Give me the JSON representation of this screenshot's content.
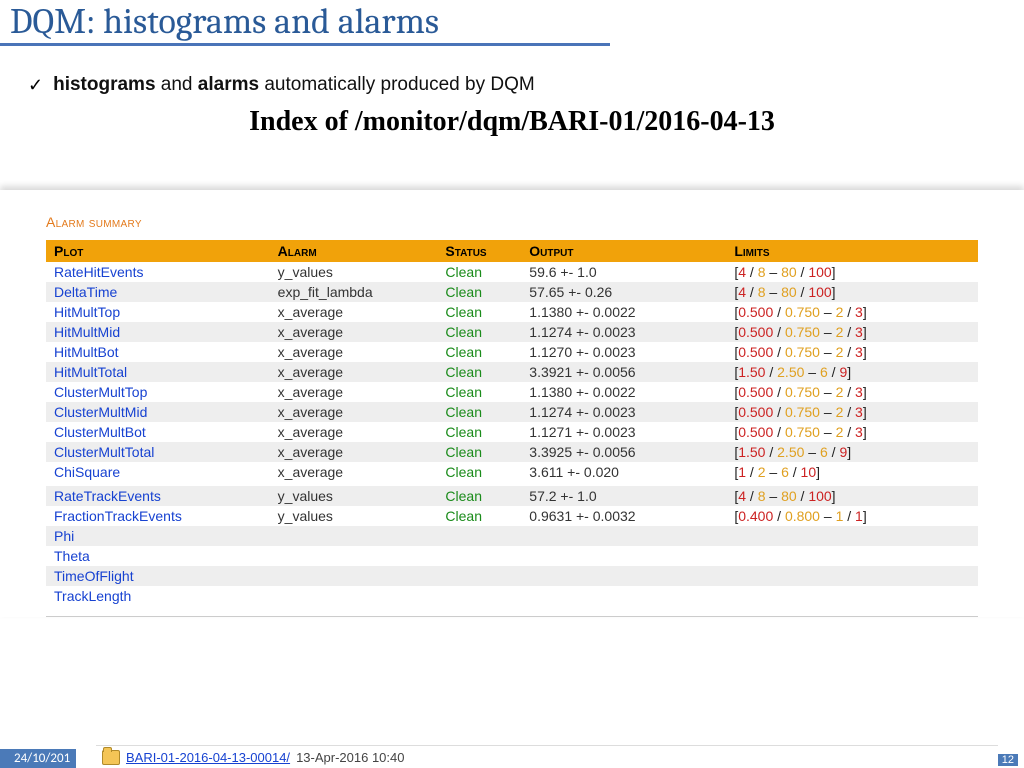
{
  "title": "DQM: histograms and alarms",
  "bullet": {
    "b1": "histograms",
    "mid": " and ",
    "b2": "alarms",
    "tail": " automatically produced by DQM"
  },
  "partial_heading": "Index of /monitor/dqm/BARI-01/2016-04-13",
  "alarm_label": "Alarm summary",
  "headers": {
    "plot": "Plot",
    "alarm": "Alarm",
    "status": "Status",
    "output": "Output",
    "limits": "Limits"
  },
  "groups": [
    {
      "rows": [
        {
          "plot": "RateHitEvents",
          "alarm": "y_values",
          "status": "Clean",
          "output": "59.6 +- 1.0",
          "lim": [
            "4",
            "8",
            "80",
            "100"
          ]
        },
        {
          "plot": "DeltaTime",
          "alarm": "exp_fit_lambda",
          "status": "Clean",
          "output": "57.65 +- 0.26",
          "lim": [
            "4",
            "8",
            "80",
            "100"
          ]
        },
        {
          "plot": "HitMultTop",
          "alarm": "x_average",
          "status": "Clean",
          "output": "1.1380 +- 0.0022",
          "lim": [
            "0.500",
            "0.750",
            "2",
            "3"
          ]
        },
        {
          "plot": "HitMultMid",
          "alarm": "x_average",
          "status": "Clean",
          "output": "1.1274 +- 0.0023",
          "lim": [
            "0.500",
            "0.750",
            "2",
            "3"
          ]
        },
        {
          "plot": "HitMultBot",
          "alarm": "x_average",
          "status": "Clean",
          "output": "1.1270 +- 0.0023",
          "lim": [
            "0.500",
            "0.750",
            "2",
            "3"
          ]
        },
        {
          "plot": "HitMultTotal",
          "alarm": "x_average",
          "status": "Clean",
          "output": "3.3921 +- 0.0056",
          "lim": [
            "1.50",
            "2.50",
            "6",
            "9"
          ]
        },
        {
          "plot": "ClusterMultTop",
          "alarm": "x_average",
          "status": "Clean",
          "output": "1.1380 +- 0.0022",
          "lim": [
            "0.500",
            "0.750",
            "2",
            "3"
          ]
        },
        {
          "plot": "ClusterMultMid",
          "alarm": "x_average",
          "status": "Clean",
          "output": "1.1274 +- 0.0023",
          "lim": [
            "0.500",
            "0.750",
            "2",
            "3"
          ]
        },
        {
          "plot": "ClusterMultBot",
          "alarm": "x_average",
          "status": "Clean",
          "output": "1.1271 +- 0.0023",
          "lim": [
            "0.500",
            "0.750",
            "2",
            "3"
          ]
        },
        {
          "plot": "ClusterMultTotal",
          "alarm": "x_average",
          "status": "Clean",
          "output": "3.3925 +- 0.0056",
          "lim": [
            "1.50",
            "2.50",
            "6",
            "9"
          ]
        },
        {
          "plot": "ChiSquare",
          "alarm": "x_average",
          "status": "Clean",
          "output": "3.611 +- 0.020",
          "lim": [
            "1",
            "2",
            "6",
            "10"
          ]
        }
      ]
    },
    {
      "rows": [
        {
          "plot": "RateTrackEvents",
          "alarm": "y_values",
          "status": "Clean",
          "output": "57.2 +- 1.0",
          "lim": [
            "4",
            "8",
            "80",
            "100"
          ]
        },
        {
          "plot": "FractionTrackEvents",
          "alarm": "y_values",
          "status": "Clean",
          "output": "0.9631 +- 0.0032",
          "lim": [
            "0.400",
            "0.800",
            "1",
            "1"
          ]
        },
        {
          "plot": "Phi"
        },
        {
          "plot": "Theta"
        },
        {
          "plot": "TimeOfFlight"
        },
        {
          "plot": "TrackLength"
        }
      ]
    }
  ],
  "footer": {
    "date": "24/10/201",
    "page": "12",
    "dir_link": "BARI-01-2016-04-13-00014/",
    "dir_date": "13-Apr-2016 10:40"
  }
}
